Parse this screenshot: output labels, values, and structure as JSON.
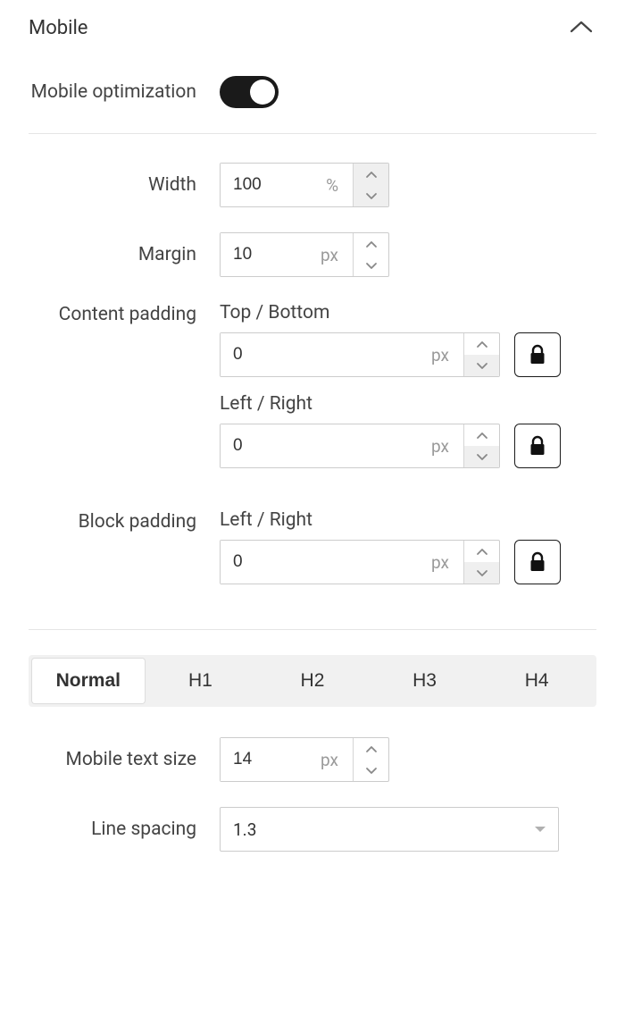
{
  "section": {
    "title": "Mobile"
  },
  "fields": {
    "mobile_optimization": {
      "label": "Mobile optimization",
      "on": true
    },
    "width": {
      "label": "Width",
      "value": "100",
      "unit": "%"
    },
    "margin": {
      "label": "Margin",
      "value": "10",
      "unit": "px"
    },
    "content_padding": {
      "label": "Content padding",
      "tb": {
        "sublabel": "Top / Bottom",
        "value": "0",
        "unit": "px"
      },
      "lr": {
        "sublabel": "Left / Right",
        "value": "0",
        "unit": "px"
      }
    },
    "block_padding": {
      "label": "Block padding",
      "lr": {
        "sublabel": "Left / Right",
        "value": "0",
        "unit": "px"
      }
    },
    "mobile_text_size": {
      "label": "Mobile text size",
      "value": "14",
      "unit": "px"
    },
    "line_spacing": {
      "label": "Line spacing",
      "value": "1.3"
    }
  },
  "tabs": {
    "items": [
      {
        "label": "Normal",
        "active": true
      },
      {
        "label": "H1",
        "active": false
      },
      {
        "label": "H2",
        "active": false
      },
      {
        "label": "H3",
        "active": false
      },
      {
        "label": "H4",
        "active": false
      }
    ]
  }
}
